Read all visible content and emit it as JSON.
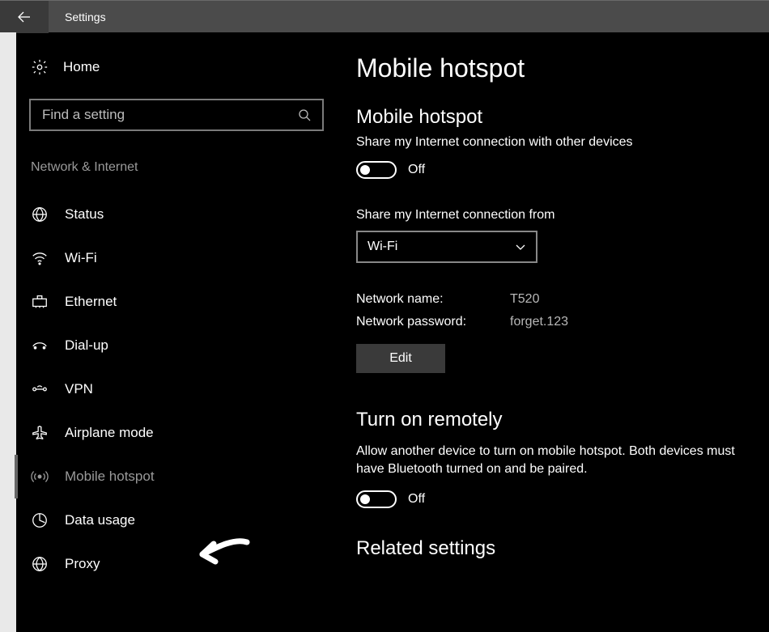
{
  "titlebar": {
    "title": "Settings"
  },
  "sidebar": {
    "home": "Home",
    "search_placeholder": "Find a setting",
    "category": "Network & Internet",
    "items": [
      {
        "label": "Status",
        "icon": "network-icon"
      },
      {
        "label": "Wi-Fi",
        "icon": "wifi-icon"
      },
      {
        "label": "Ethernet",
        "icon": "ethernet-icon"
      },
      {
        "label": "Dial-up",
        "icon": "dialup-icon"
      },
      {
        "label": "VPN",
        "icon": "vpn-icon"
      },
      {
        "label": "Airplane mode",
        "icon": "airplane-icon"
      },
      {
        "label": "Mobile hotspot",
        "icon": "hotspot-icon",
        "active": true
      },
      {
        "label": "Data usage",
        "icon": "data-usage-icon"
      },
      {
        "label": "Proxy",
        "icon": "proxy-icon"
      }
    ]
  },
  "main": {
    "title": "Mobile hotspot",
    "section1": {
      "heading": "Mobile hotspot",
      "desc": "Share my Internet connection with other devices",
      "toggle_state": "Off"
    },
    "share_from": {
      "label": "Share my Internet connection from",
      "value": "Wi-Fi"
    },
    "network": {
      "name_label": "Network name:",
      "name_value": "T520",
      "pass_label": "Network password:",
      "pass_value": "forget.123",
      "edit": "Edit"
    },
    "remote": {
      "heading": "Turn on remotely",
      "desc": "Allow another device to turn on mobile hotspot. Both devices must have Bluetooth turned on and be paired.",
      "toggle_state": "Off"
    },
    "related": {
      "heading": "Related settings"
    }
  }
}
